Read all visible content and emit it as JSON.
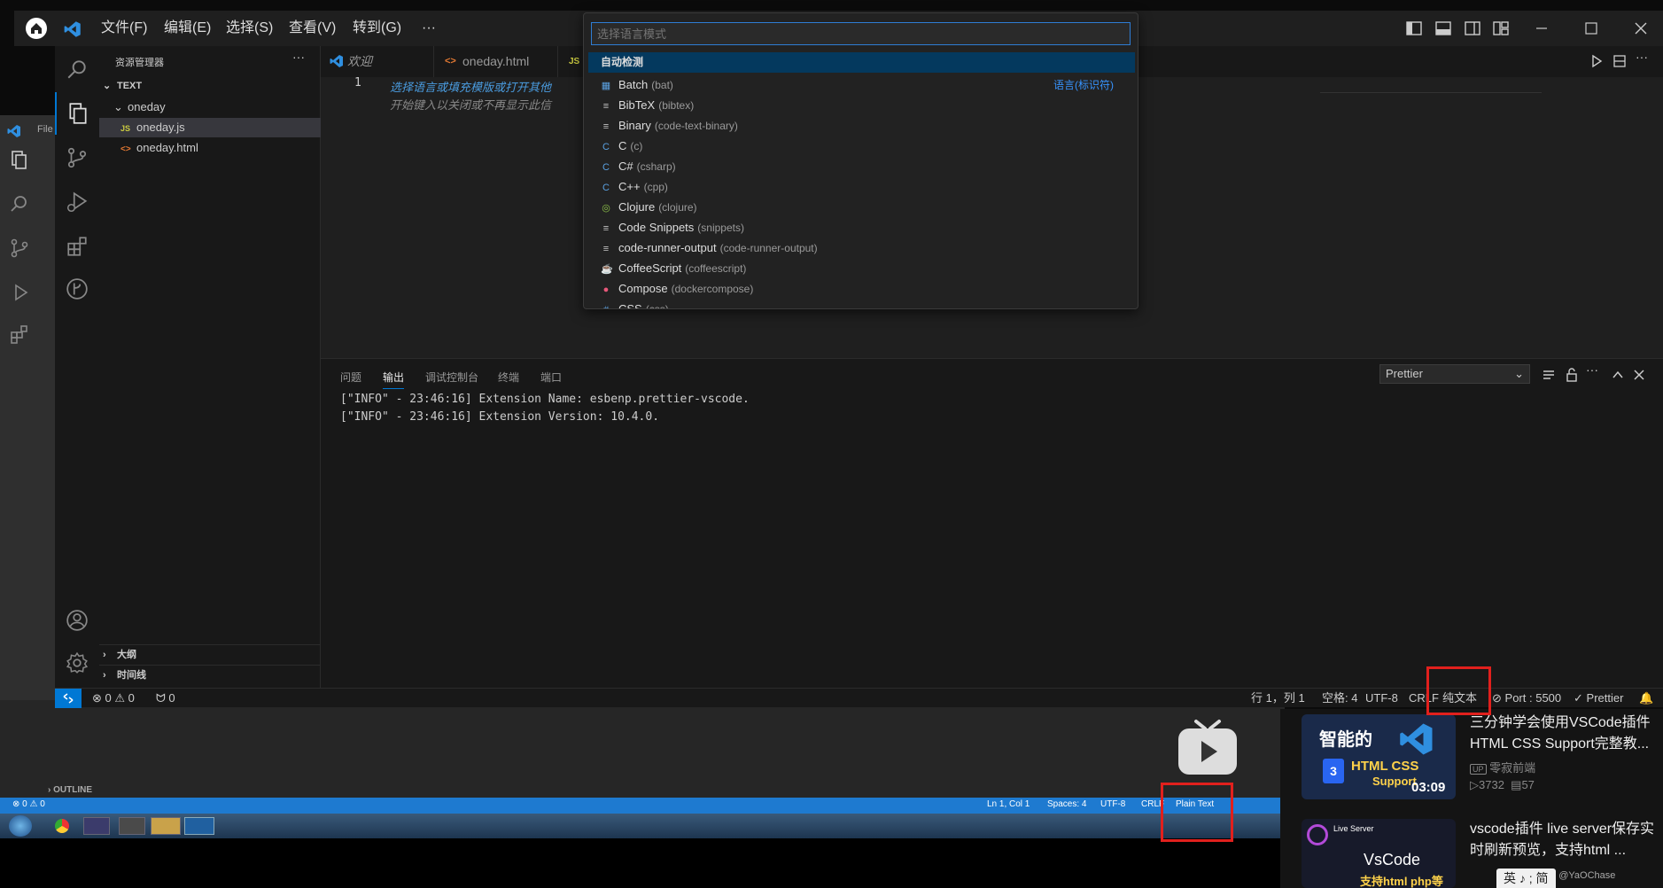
{
  "titlebar": {
    "menus": [
      "文件(F)",
      "编辑(E)",
      "选择(S)",
      "查看(V)",
      "转到(G)",
      "···"
    ]
  },
  "sidebar": {
    "title": "资源管理器",
    "more": "···",
    "folder_root": "TEXT",
    "folder": "oneday",
    "files": [
      {
        "name": "oneday.js",
        "icon": "JS"
      },
      {
        "name": "oneday.html",
        "icon": "<>"
      }
    ],
    "sections": [
      "大纲",
      "时间线"
    ]
  },
  "tabs": [
    {
      "label": "欢迎"
    },
    {
      "label": "oneday.html"
    },
    {
      "label": "JS"
    }
  ],
  "editor": {
    "line_number": "1",
    "hint_line1": "选择语言或填充模版或打开其他",
    "hint_line2": "开始键入以关闭或不再显示此信"
  },
  "quickpick": {
    "placeholder": "选择语言模式",
    "header": "自动检测",
    "header_right": "语言(标识符)",
    "items": [
      {
        "name": "Batch",
        "id": "(bat)",
        "icon": "▦",
        "color": "#5aa0e0"
      },
      {
        "name": "BibTeX",
        "id": "(bibtex)",
        "icon": "≡",
        "color": "#c5c5c5"
      },
      {
        "name": "Binary",
        "id": "(code-text-binary)",
        "icon": "≡",
        "color": "#c5c5c5"
      },
      {
        "name": "C",
        "id": "(c)",
        "icon": "C",
        "color": "#5aa0e0"
      },
      {
        "name": "C#",
        "id": "(csharp)",
        "icon": "C",
        "color": "#5aa0e0"
      },
      {
        "name": "C++",
        "id": "(cpp)",
        "icon": "C",
        "color": "#5aa0e0"
      },
      {
        "name": "Clojure",
        "id": "(clojure)",
        "icon": "◎",
        "color": "#8dc149"
      },
      {
        "name": "Code Snippets",
        "id": "(snippets)",
        "icon": "≡",
        "color": "#c5c5c5"
      },
      {
        "name": "code-runner-output",
        "id": "(code-runner-output)",
        "icon": "≡",
        "color": "#c5c5c5"
      },
      {
        "name": "CoffeeScript",
        "id": "(coffeescript)",
        "icon": "☕",
        "color": "#cbcb41"
      },
      {
        "name": "Compose",
        "id": "(dockercompose)",
        "icon": "●",
        "color": "#e8587a"
      },
      {
        "name": "CSS",
        "id": "(css)",
        "icon": "#",
        "color": "#5aa0e0"
      }
    ]
  },
  "panel": {
    "tabs": [
      "问题",
      "输出",
      "调试控制台",
      "终端",
      "端口"
    ],
    "active_tab": "输出",
    "channel": "Prettier",
    "output_lines": [
      "[\"INFO\" - 23:46:16] Extension Name: esbenp.prettier-vscode.",
      "[\"INFO\" - 23:46:16] Extension Version: 10.4.0."
    ],
    "more": "···"
  },
  "statusbar": {
    "errors": "0",
    "warnings": "0",
    "ports": "0",
    "position": "行 1，列 1",
    "spaces": "空格: 4",
    "encoding": "UTF-8",
    "eol": "CRLF",
    "language": "纯文本",
    "port": "Port : 5500",
    "formatter": "Prettier"
  },
  "background": {
    "file_label": "File",
    "outline": "OUTLINE",
    "status_counts": "0 ⚠ 0",
    "status_items": [
      "Ln 1, Col 1",
      "Spaces: 4",
      "UTF-8",
      "CRLF",
      "Plain Text"
    ]
  },
  "videos": [
    {
      "title": "三分钟学会使用VSCode插件HTML CSS Support完整教...",
      "thumb_title": "智能的",
      "thumb_sub": "HTML CSS",
      "thumb_sub2": "Support",
      "duration": "03:09",
      "author": "零寂前端",
      "views": "3732",
      "comments": "57"
    },
    {
      "title": "vscode插件 live server保存实时刷新预览，支持html ...",
      "thumb_title": "Live Server",
      "thumb_sub": "VsCode",
      "thumb_sub2": "支持html php等"
    }
  ],
  "watermark": "CSDN @YaOChase",
  "ime": "英 ♪ ; 简",
  "colors": {
    "accent": "#0078d4",
    "highlight_box": "#e1201d",
    "statusbar_remote": "#0078d4"
  }
}
